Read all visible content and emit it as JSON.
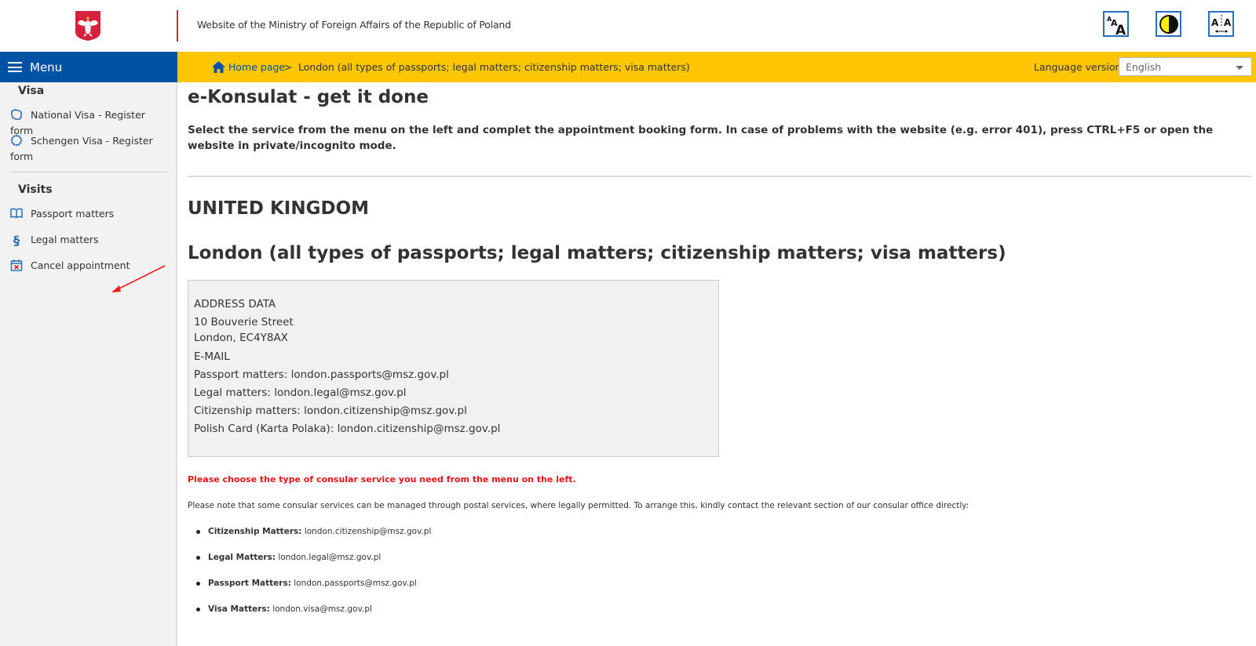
{
  "header": {
    "site_title": "Website of the Ministry of Foreign Affairs of the Republic of Poland",
    "emblem": "polish-eagle-emblem",
    "accessibility_buttons": [
      {
        "name": "font-size",
        "icon": "font-size-icon"
      },
      {
        "name": "contrast",
        "icon": "contrast-icon"
      },
      {
        "name": "letter-spacing",
        "icon": "letter-spacing-icon"
      }
    ]
  },
  "menu": {
    "label": "Menu",
    "icon": "hamburger-icon"
  },
  "breadcrumb": {
    "home_label": "Home page",
    "separator": ">",
    "current": "London (all types of passports; legal matters; citizenship matters; visa matters)"
  },
  "language": {
    "label": "Language version",
    "selected": "English"
  },
  "sidebar": {
    "sections": [
      {
        "heading": "Visa",
        "items": [
          {
            "label": "National Visa -  Register form",
            "icon": "poland-map-icon"
          },
          {
            "label": "Schengen Visa -  Register form",
            "icon": "eu-stars-icon"
          }
        ]
      },
      {
        "heading": "Visits",
        "items": [
          {
            "label": "Passport matters",
            "icon": "book-icon"
          },
          {
            "label": "Legal matters",
            "icon": "paragraph-icon"
          },
          {
            "label": "Cancel appointment",
            "icon": "calendar-cancel-icon"
          }
        ]
      }
    ]
  },
  "main": {
    "title": "e-Konsulat - get it done",
    "intro": "Select the service from the menu on the left and complet the appointment booking form. In case of problems with the website (e.g. error 401), press CTRL+F5 or open the website in private/incognito mode.",
    "country": "UNITED KINGDOM",
    "office": "London (all types of passports; legal matters; citizenship matters; visa matters)",
    "address_box": {
      "address_heading": "ADDRESS DATA",
      "street": "10 Bouverie Street",
      "city": "London, EC4Y8AX",
      "email_heading": "E-MAIL",
      "emails": [
        "Passport matters: london.passports@msz.gov.pl",
        "Legal matters: london.legal@msz.gov.pl",
        "Citizenship matters: london.citizenship@msz.gov.pl",
        "Polish Card (Karta Polaka): london.citizenship@msz.gov.pl"
      ]
    },
    "warning": "Please choose the type of consular service you need from the menu on the left.",
    "note": "Please note that some consular services can be managed through postal services, where legally permitted. To arrange this, kindly contact the relevant section of our consular office directly:",
    "contacts": [
      {
        "label": "Citizenship Matters:",
        "email": "london.citizenship@msz.gov.pl"
      },
      {
        "label": "Legal Matters:",
        "email": "london.legal@msz.gov.pl"
      },
      {
        "label": "Passport Matters:",
        "email": "london.passports@msz.gov.pl"
      },
      {
        "label": "Visa Matters:",
        "email": "london.visa@msz.gov.pl"
      }
    ]
  },
  "colors": {
    "menu_blue": "#0052a5",
    "breadcrumb_yellow": "#ffc600",
    "warning_red": "#e8141c",
    "divider_red": "#d4213d",
    "icon_blue": "#2c6fb7"
  }
}
